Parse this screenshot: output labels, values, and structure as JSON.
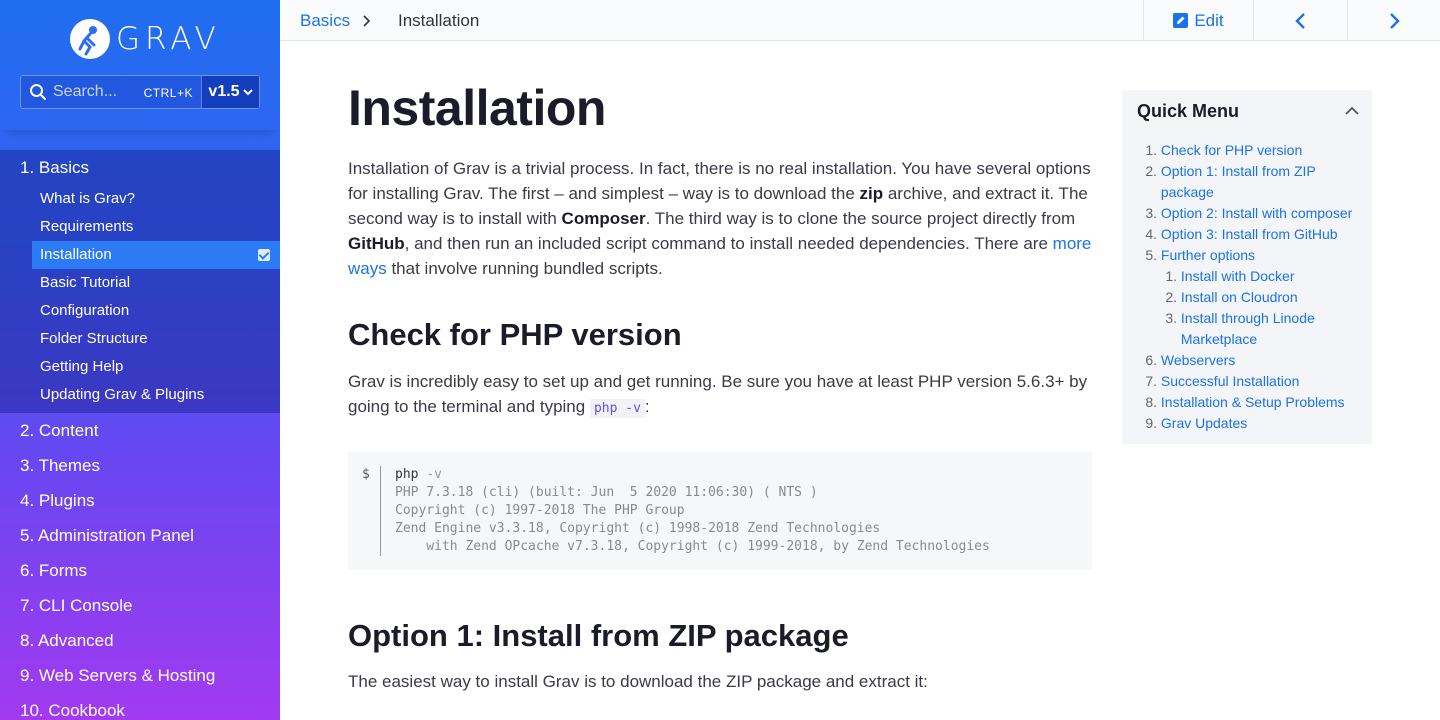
{
  "brand": {
    "logo_text": "GRAV"
  },
  "search": {
    "placeholder": "Search...",
    "shortcut": "CTRL+K",
    "version": "v1.5"
  },
  "nav": {
    "sections": [
      {
        "label": "1. Basics",
        "open": true,
        "children": [
          "What is Grav?",
          "Requirements",
          "Installation",
          "Basic Tutorial",
          "Configuration",
          "Folder Structure",
          "Getting Help",
          "Updating Grav & Plugins"
        ]
      },
      {
        "label": "2. Content"
      },
      {
        "label": "3. Themes"
      },
      {
        "label": "4. Plugins"
      },
      {
        "label": "5. Administration Panel"
      },
      {
        "label": "6. Forms"
      },
      {
        "label": "7. CLI Console"
      },
      {
        "label": "8. Advanced"
      },
      {
        "label": "9. Web Servers & Hosting"
      },
      {
        "label": "10. Cookbook"
      }
    ],
    "active_child": "Installation"
  },
  "topbar": {
    "crumb_parent": "Basics",
    "crumb_current": "Installation",
    "edit_label": "Edit"
  },
  "page": {
    "title": "Installation",
    "intro": {
      "p1": "Installation of Grav is a trivial process. In fact, there is no real installation. You have several options for installing Grav. The first – and simplest – way is to download the ",
      "b1": "zip",
      "p2": " archive, and extract it. The second way is to install with ",
      "b2": "Composer",
      "p3": ". The third way is to clone the source project directly from ",
      "b3": "GitHub",
      "p4": ", and then run an included script command to install needed dependencies. There are ",
      "link": "more ways",
      "p5": " that involve running bundled scripts."
    },
    "sec1": {
      "title": "Check for PHP version",
      "text_a": "Grav is incredibly easy to set up and get running. Be sure you have at least PHP version 5.6.3+ by going to the terminal and typing ",
      "code": "php -v",
      "text_b": ":"
    },
    "code": {
      "prompt": "$",
      "cmd": "php",
      "flag": "-v",
      "out1": "PHP 7.3.18 (cli) (built: Jun  5 2020 11:06:30) ( NTS )",
      "out2": "Copyright (c) 1997-2018 The PHP Group",
      "out3": "Zend Engine v3.3.18, Copyright (c) 1998-2018 Zend Technologies",
      "out4": "    with Zend OPcache v7.3.18, Copyright (c) 1999-2018, by Zend Technologies"
    },
    "sec2": {
      "title": "Option 1: Install from ZIP package",
      "text": "The easiest way to install Grav is to download the ZIP package and extract it:"
    }
  },
  "quick_menu": {
    "title": "Quick Menu",
    "items": [
      {
        "num": "1.",
        "label": "Check for PHP version"
      },
      {
        "num": "2.",
        "label": "Option 1: Install from ZIP package"
      },
      {
        "num": "3.",
        "label": "Option 2: Install with composer"
      },
      {
        "num": "4.",
        "label": "Option 3: Install from GitHub"
      },
      {
        "num": "5.",
        "label": "Further options"
      },
      {
        "num": "1.",
        "label": "Install with Docker",
        "sub": true
      },
      {
        "num": "2.",
        "label": "Install on Cloudron",
        "sub": true
      },
      {
        "num": "3.",
        "label": "Install through Linode Marketplace",
        "sub": true
      },
      {
        "num": "6.",
        "label": "Webservers"
      },
      {
        "num": "7.",
        "label": "Successful Installation"
      },
      {
        "num": "8.",
        "label": "Installation & Setup Problems"
      },
      {
        "num": "9.",
        "label": "Grav Updates"
      }
    ]
  },
  "icons": {
    "search": "search-icon",
    "edit": "edit-icon",
    "prev": "chevron-left-icon",
    "next": "chevron-right-icon",
    "collapse": "chevron-up-icon",
    "version_dropdown": "chevron-down-icon",
    "active_marker": "check-icon"
  },
  "colors": {
    "accent": "#1a73e8",
    "sidebar_top": "#1f6ef0",
    "sidebar_bottom": "#a23af0",
    "active_item": "#2b7bf5"
  }
}
